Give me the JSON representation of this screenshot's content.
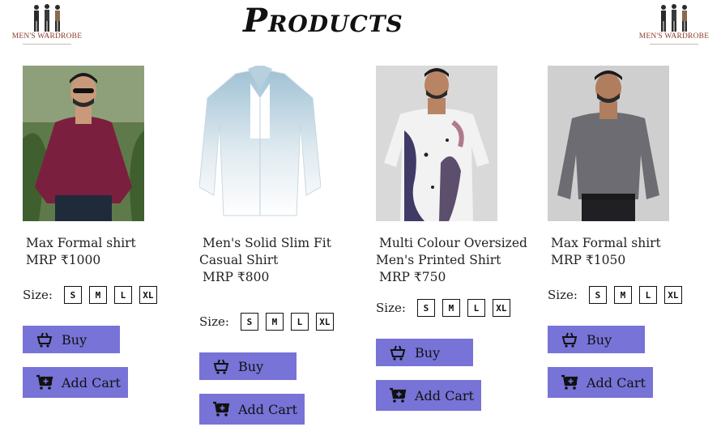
{
  "header": {
    "title": "Products",
    "logo_left": {
      "brand": "MEN'S WARDROBE"
    },
    "logo_right": {
      "brand": "MEN'S WARDROBE"
    }
  },
  "size_label": "Size:",
  "sizes": [
    "S",
    "M",
    "L",
    "XL"
  ],
  "buttons": {
    "buy": "Buy",
    "add_cart": "Add Cart"
  },
  "icons": {
    "buy": "basket-icon",
    "add_cart": "add-to-cart-icon"
  },
  "products": [
    {
      "name_lines": [
        "Max Formal shirt"
      ],
      "price": "MRP ₹1000",
      "shirt_color": "#7b1f3f",
      "image": "man-in-maroon-shirt-photo"
    },
    {
      "name_lines": [
        "Men's Solid Slim Fit",
        "Casual Shirt"
      ],
      "price": "MRP ₹800",
      "shirt_color": "#a9c6d6",
      "image": "white-blue-gradient-shirt-photo"
    },
    {
      "name_lines": [
        "Multi Colour Oversized",
        "Men's Printed Shirt"
      ],
      "price": "MRP ₹750",
      "shirt_color": "#f2f2f2",
      "image": "man-in-printed-shirt-photo"
    },
    {
      "name_lines": [
        "Max Formal shirt"
      ],
      "price": "MRP ₹1050",
      "shirt_color": "#6c6c72",
      "image": "man-in-grey-shirt-photo"
    }
  ],
  "colors": {
    "button": "#7773d7",
    "brand": "#8c3a2a"
  }
}
